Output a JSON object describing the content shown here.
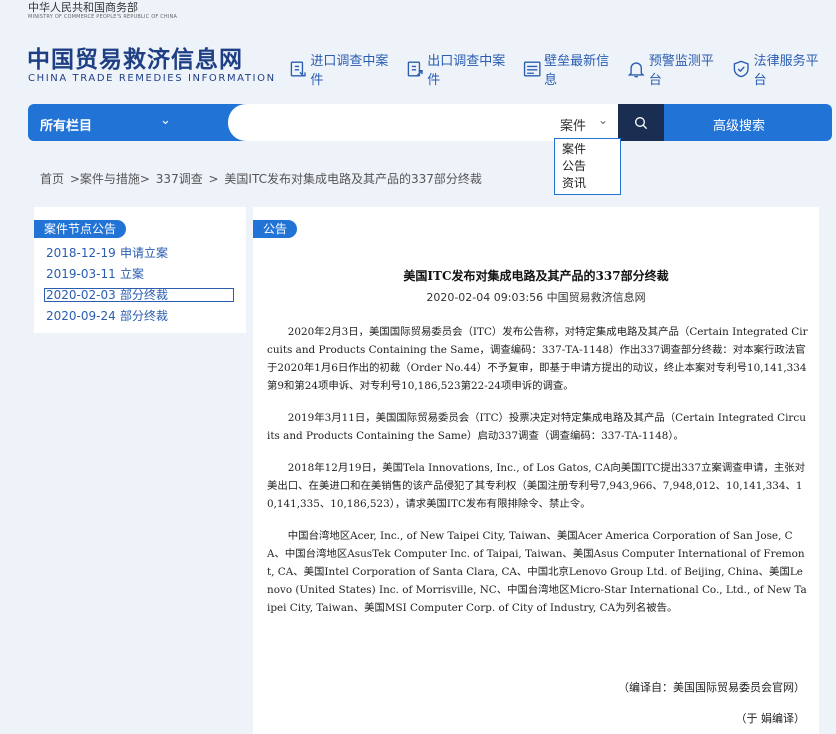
{
  "header": {
    "ministry_cn": "中华人民共和国商务部",
    "ministry_en": "MINISTRY OF COMMERCE PEOPLE'S REPUBLIC OF CHINA",
    "brand_cn": "中国贸易救济信息网",
    "brand_en": "CHINA TRADE REMEDIES INFORMATION"
  },
  "topnav": [
    {
      "label": "进口调查中案件",
      "icon": "import-investigation-icon"
    },
    {
      "label": "出口调查中案件",
      "icon": "export-investigation-icon"
    },
    {
      "label": "壁垒最新信息",
      "icon": "barrier-info-icon"
    },
    {
      "label": "预警监测平台",
      "icon": "bell-icon"
    },
    {
      "label": "法律服务平台",
      "icon": "shield-icon"
    }
  ],
  "search": {
    "all_columns": "所有栏目",
    "value": "",
    "category": "案件",
    "advanced": "高级搜索",
    "options": [
      "案件",
      "公告",
      "资讯"
    ]
  },
  "breadcrumb": [
    "首页",
    ">案件与措施>",
    "337调查",
    ">",
    "美国ITC发布对集成电路及其产品的337部分终裁"
  ],
  "left_panel": {
    "title": "案件节点公告",
    "items": [
      {
        "date": "2018-12-19",
        "label": "申请立案"
      },
      {
        "date": "2019-03-11",
        "label": "立案"
      },
      {
        "date": "2020-02-03",
        "label": "部分终裁"
      },
      {
        "date": "2020-09-24",
        "label": "部分终裁"
      }
    ]
  },
  "article": {
    "tag": "公告",
    "title": "美国ITC发布对集成电路及其产品的337部分终裁",
    "meta": "2020-02-04 09:03:56   中国贸易救济信息网",
    "paragraphs": [
      "2020年2月3日，美国国际贸易委员会（ITC）发布公告称，对特定集成电路及其产品（Certain Integrated Circuits and Products Containing the Same，调查编码：337-TA-1148）作出337调查部分终裁：对本案行政法官于2020年1月6日作出的初裁（Order No.44）不予复审，即基于申请方提出的动议，终止本案对专利号10,141,334第9和第24项申诉、对专利号10,186,523第22-24项申诉的调查。",
      "2019年3月11日，美国国际贸易委员会（ITC）投票决定对特定集成电路及其产品（Certain Integrated Circuits and Products Containing the Same）启动337调查（调查编码：337-TA-1148）。",
      "2018年12月19日，美国Tela Innovations, Inc., of Los Gatos, CA向美国ITC提出337立案调查申请，主张对美出口、在美进口和在美销售的该产品侵犯了其专利权（美国注册专利号7,943,966、7,948,012、10,141,334、10,141,335、10,186,523），请求美国ITC发布有限排除令、禁止令。",
      "中国台湾地区Acer, Inc., of New Taipei City, Taiwan、美国Acer America Corporation of San Jose, CA、中国台湾地区AsusTek Computer Inc. of Taipai, Taiwan、美国Asus Computer International of Fremont, CA、美国Intel Corporation of Santa Clara, CA、中国北京Lenovo Group Ltd. of Beijing, China、美国Lenovo (United States) Inc. of Morrisville, NC、中国台湾地区Micro-Star International Co., Ltd., of New Taipei City, Taiwan、美国MSI Computer Corp. of City of Industry, CA为列名被告。"
    ],
    "source": "（编译自：美国国际贸易委员会官网）",
    "editor": "（于  娟编译）"
  }
}
